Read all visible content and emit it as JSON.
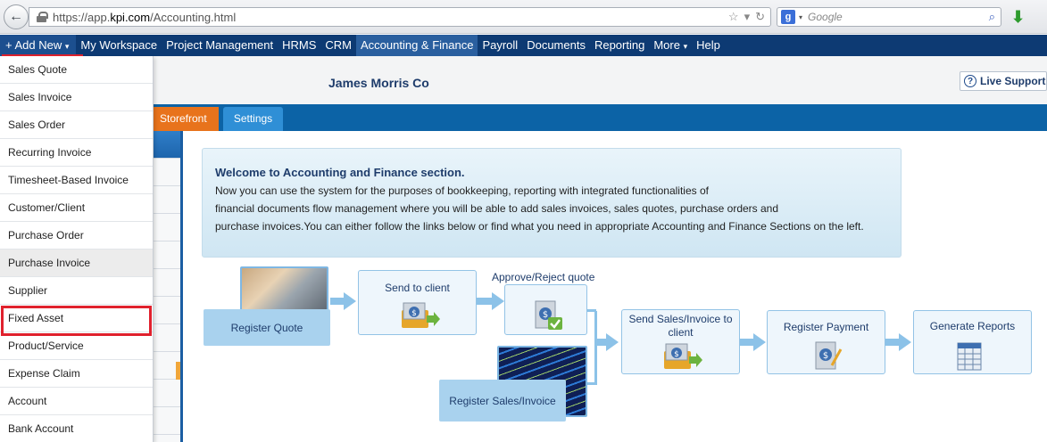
{
  "browser": {
    "url_prefix": "https://app.",
    "url_domain": "kpi.com",
    "url_path": "/Accounting.html",
    "search_placeholder": "Google",
    "search_engine_letter": "g"
  },
  "nav": {
    "add_new": "+ Add New",
    "items": [
      "My Workspace",
      "Project Management",
      "HRMS",
      "CRM",
      "Accounting & Finance",
      "Payroll",
      "Documents",
      "Reporting",
      "More",
      "Help"
    ]
  },
  "header": {
    "company": "James Morris Co",
    "live_support": "Live Support"
  },
  "tabs": {
    "storefront": "Storefront",
    "settings": "Settings"
  },
  "welcome": {
    "title": "Welcome to Accounting and Finance section.",
    "lines": [
      "Now you can use the system for the purposes of bookkeeping, reporting with integrated functionalities of",
      "financial documents flow management where you will be able to add sales invoices, sales quotes, purchase orders and",
      "purchase invoices.You can either follow the links below or find what you need in appropriate Accounting and Finance Sections on the left."
    ]
  },
  "workflow": {
    "register_quote": "Register Quote",
    "send_to_client": "Send to client",
    "approve_reject": "Approve/Reject quote",
    "send_sales_invoice": "Send Sales/Invoice to client",
    "register_sales_invoice": "Register Sales/Invoice",
    "register_payment": "Register Payment",
    "generate_reports": "Generate Reports"
  },
  "dropdown": {
    "items": [
      "Sales Quote",
      "Sales Invoice",
      "Sales Order",
      "Recurring Invoice",
      "Timesheet-Based Invoice",
      "Customer/Client",
      "Purchase Order",
      "Purchase Invoice",
      "Supplier",
      "Fixed Asset",
      "Product/Service",
      "Expense Claim",
      "Account",
      "Bank Account"
    ],
    "highlighted": "Purchase Invoice"
  },
  "colors": {
    "nav_bg": "#0d3a73",
    "tab_bar": "#0c63a6",
    "storefront": "#e8731c",
    "highlight_red": "#e0212d"
  }
}
